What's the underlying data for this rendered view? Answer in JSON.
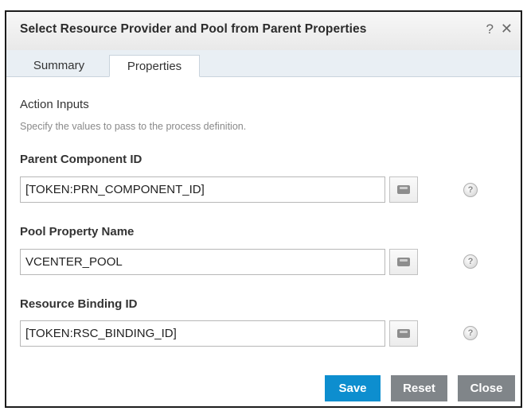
{
  "dialog": {
    "title": "Select Resource Provider and Pool from Parent Properties",
    "help_label": "?",
    "close_label": "✕"
  },
  "tabs": [
    {
      "label": "Summary",
      "active": false
    },
    {
      "label": "Properties",
      "active": true
    }
  ],
  "section": {
    "title": "Action Inputs",
    "description": "Specify the values to pass to the process definition."
  },
  "fields": [
    {
      "label": "Parent Component ID",
      "value": "[TOKEN:PRN_COMPONENT_ID]"
    },
    {
      "label": "Pool Property Name",
      "value": "VCENTER_POOL"
    },
    {
      "label": "Resource Binding ID",
      "value": "[TOKEN:RSC_BINDING_ID]"
    }
  ],
  "field_help_glyph": "?",
  "buttons": {
    "save": "Save",
    "reset": "Reset",
    "close": "Close"
  },
  "colors": {
    "primary": "#0d8ecf",
    "secondary": "#808589"
  },
  "icons": {
    "field_selector": "tray-icon",
    "field_help": "help-circle-icon"
  }
}
